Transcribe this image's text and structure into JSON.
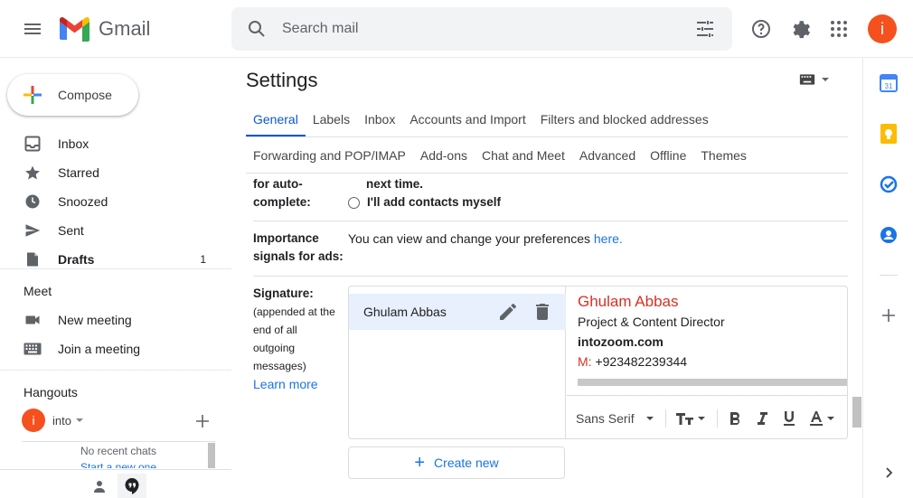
{
  "header": {
    "app_name": "Gmail",
    "search_placeholder": "Search mail",
    "avatar_letter": "i"
  },
  "leftnav": {
    "compose_label": "Compose",
    "items": [
      {
        "label": "Inbox",
        "icon": "inbox-icon"
      },
      {
        "label": "Starred",
        "icon": "star-icon"
      },
      {
        "label": "Snoozed",
        "icon": "clock-icon"
      },
      {
        "label": "Sent",
        "icon": "send-icon"
      },
      {
        "label": "Drafts",
        "icon": "draft-icon",
        "count": "1"
      }
    ],
    "meet": {
      "title": "Meet",
      "new_meeting": "New meeting",
      "join_meeting": "Join a meeting"
    },
    "hangouts": {
      "title": "Hangouts",
      "user_letter": "i",
      "user_name": "into",
      "no_chats": "No recent chats",
      "start_new": "Start a new one"
    }
  },
  "settings": {
    "title": "Settings",
    "tabs_row1": [
      "General",
      "Labels",
      "Inbox",
      "Accounts and Import",
      "Filters and blocked addresses"
    ],
    "tabs_row2": [
      "Forwarding and POP/IMAP",
      "Add-ons",
      "Chat and Meet",
      "Advanced",
      "Offline",
      "Themes"
    ],
    "autocomplete": {
      "label_line1": "for auto-",
      "label_line2": "complete:",
      "text_next_time": "next time.",
      "option_manual": "I'll add contacts myself"
    },
    "importance": {
      "label_line1": "Importance",
      "label_line2": "signals for ads:",
      "text": "You can view and change your preferences",
      "link": "here."
    },
    "signature": {
      "label": "Signature:",
      "desc_line1": "(appended at the",
      "desc_line2": "end of all",
      "desc_line3": "outgoing",
      "desc_line4": "messages)",
      "learn_more": "Learn more",
      "sig_name": "Ghulam Abbas",
      "content_name": "Ghulam Abbas",
      "content_title": "Project & Content Director",
      "content_company": "intozoom.com",
      "content_m_label": "M:",
      "content_phone": "+923482239344",
      "font_name": "Sans Serif",
      "create_new": "Create new"
    }
  },
  "colors": {
    "accent": "#1a73e8",
    "avatar": "#f4511e",
    "sig_red": "#d93025"
  }
}
